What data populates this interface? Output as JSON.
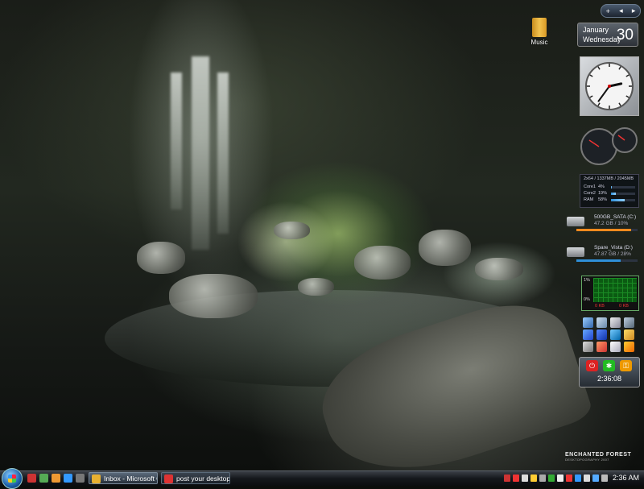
{
  "desktop": {
    "icons": [
      {
        "label": "Music",
        "icon": "folder-icon"
      }
    ],
    "wallpaper": {
      "title": "ENCHANTED FOREST",
      "subtitle": "DESKTOPOGRAPHY 2007"
    }
  },
  "sidebar": {
    "add_label": "+",
    "calendar": {
      "month": "January",
      "weekday": "Wednesday",
      "day": "30"
    },
    "clock": {
      "hour": 2,
      "minute": 36
    },
    "sysmon": {
      "header": "2x64 / 1337MB / 2045MB",
      "rows": [
        {
          "label": "Core1",
          "value": "4%",
          "level": 4
        },
        {
          "label": "Core2",
          "value": "19%",
          "level": 19
        },
        {
          "label": "RAM",
          "value": "58%",
          "level": 58
        }
      ]
    },
    "drives": [
      {
        "name": "500GB_SATA (C:)",
        "stats": "47.2 GB / 10%",
        "level": 90,
        "color": "#f08a1e"
      },
      {
        "name": "Spare_Vista (D:)",
        "stats": "47.87 GB / 28%",
        "level": 72,
        "color": "#2f8fd8"
      }
    ],
    "network": {
      "top_percent": "1%",
      "bottom_percent": "0%",
      "down": "0 KB",
      "up": "0 KB"
    },
    "launcher_icons": [
      "monitor-icon",
      "network-icon",
      "mycomputer-icon",
      "recycle-icon",
      "explorer-icon",
      "word-icon",
      "ie-icon",
      "folder-icon",
      "settings-icon",
      "media-icon",
      "document-icon",
      "app-icon"
    ],
    "shutdown": {
      "time": "2:36:08"
    }
  },
  "taskbar": {
    "tasks": [
      {
        "label": "Inbox - Microsoft O...",
        "icon": "outlook-icon"
      },
      {
        "label": "post your desktop! s...",
        "icon": "firefox-icon"
      }
    ],
    "clock": "2:36 AM"
  },
  "colors": {
    "accent": "#2f8fd8",
    "net_graph": "#0b5a12",
    "drive_c": "#f08a1e"
  }
}
